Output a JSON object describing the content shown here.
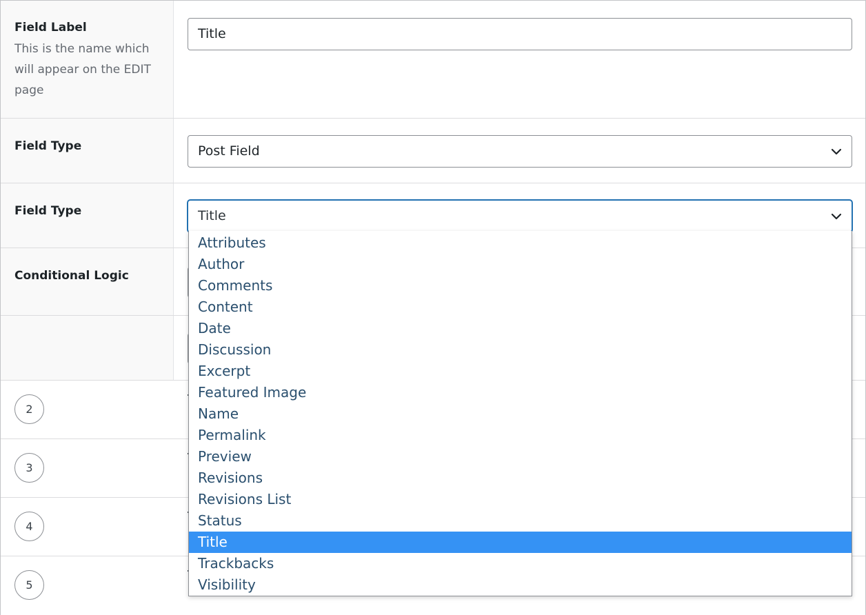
{
  "fields": {
    "field_label": {
      "title": "Field Label",
      "description": "This is the name which will appear on the EDIT page",
      "value": "Title"
    },
    "field_type_1": {
      "title": "Field Type",
      "selected": "Post Field"
    },
    "field_type_2": {
      "title": "Field Type",
      "selected": "Title"
    },
    "conditional_logic": {
      "title": "Conditional Logic"
    }
  },
  "numbered_rows": [
    "2",
    "3",
    "4",
    "5"
  ],
  "dropdown": {
    "options": [
      "Attributes",
      "Author",
      "Comments",
      "Content",
      "Date",
      "Discussion",
      "Excerpt",
      "Featured Image",
      "Name",
      "Permalink",
      "Preview",
      "Revisions",
      "Revisions List",
      "Status",
      "Title",
      "Trackbacks",
      "Visibility"
    ],
    "selected": "Title",
    "highlight_color": "#3592f4"
  },
  "icons": {
    "select_arrow": "chevron-down-icon"
  }
}
